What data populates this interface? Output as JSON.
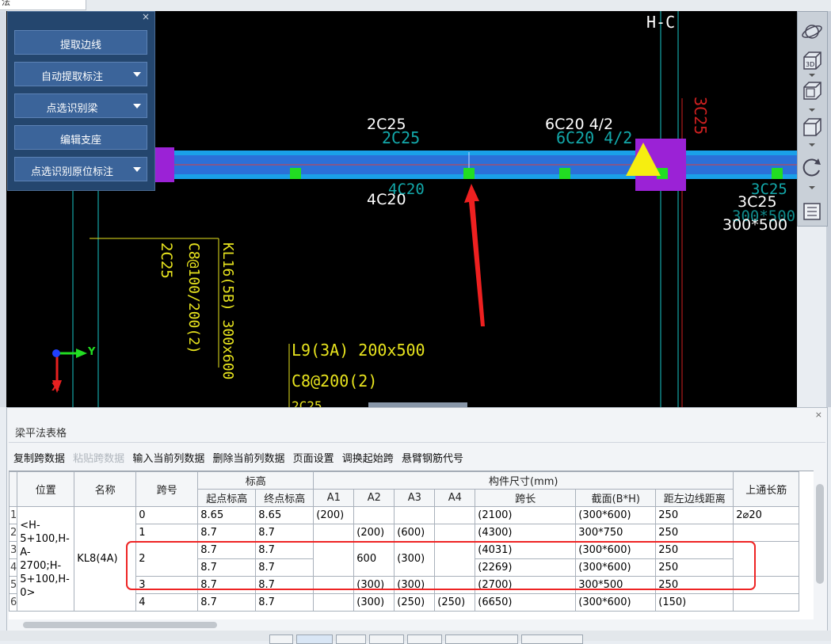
{
  "top_strip_text": "法",
  "panel": {
    "close": "×",
    "buttons": [
      {
        "label": "提取边线",
        "dropdown": false
      },
      {
        "label": "自动提取标注",
        "dropdown": true
      },
      {
        "label": "点选识别梁",
        "dropdown": true
      },
      {
        "label": "编辑支座",
        "dropdown": false
      },
      {
        "label": "点选识别原位标注",
        "dropdown": true
      }
    ]
  },
  "canvas": {
    "axis_label": "H-C",
    "labels": {
      "top_2c25": "2C25",
      "top_2c25_ghost": "2C25",
      "top_6c20": "6C20 4/2",
      "top_6c20_ghost": "6C20 4/2",
      "bottom_4c20": "4C20",
      "bottom_4c20_ghost": "4C20",
      "right_3c25": "3C25",
      "right_3c25_ghost": "3C25",
      "right_300": "300*500",
      "right_300_ghost": "300*500",
      "vertical_3c25": "3C25",
      "vertical_2c25": "2C25",
      "vertical_c8": "C8@100/200(2)",
      "vertical_kl16": "KL16(5B) 300x600",
      "l9": "L9(3A) 200x500",
      "c8_200": "C8@200(2)",
      "partial": "2C25",
      "ucs_x": "X",
      "ucs_y": "Y"
    }
  },
  "toolbar": {
    "icons": [
      "orbit-icon",
      "3d-view-icon",
      "top-view-icon",
      "box-view-icon",
      "rotate-icon",
      "properties-icon"
    ],
    "label_3d": "3D"
  },
  "table_panel": {
    "close": "×",
    "title": "梁平法表格",
    "actions": [
      {
        "label": "复制跨数据",
        "enabled": true
      },
      {
        "label": "粘贴跨数据",
        "enabled": false
      },
      {
        "label": "输入当前列数据",
        "enabled": true
      },
      {
        "label": "删除当前列数据",
        "enabled": true
      },
      {
        "label": "页面设置",
        "enabled": true
      },
      {
        "label": "调换起始跨",
        "enabled": true
      },
      {
        "label": "悬臂钢筋代号",
        "enabled": true
      }
    ],
    "headers": {
      "position": "位置",
      "name": "名称",
      "span": "跨号",
      "elevation": "标高",
      "start_elev": "起点标高",
      "end_elev": "终点标高",
      "dims": "构件尺寸(mm)",
      "a1": "A1",
      "a2": "A2",
      "a3": "A3",
      "a4": "A4",
      "span_len": "跨长",
      "section": "截面(B*H)",
      "left_dist": "距左边线距离",
      "top_rebar": "上通长筋"
    },
    "position_value": "<H-5+100,H-A-2700;H-5+100,H-0>",
    "name_value": "KL8(4A)",
    "row_numbers": [
      "1",
      "2",
      "3",
      "4",
      "5",
      "6"
    ],
    "rows": [
      {
        "span": "0",
        "start": "8.65",
        "end": "8.65",
        "a1": "(200)",
        "a2": "",
        "a3": "",
        "a4": "",
        "len": "(2100)",
        "sec": "(300*600)",
        "dist": "250",
        "top": "2⌀20"
      },
      {
        "span": "1",
        "start": "8.7",
        "end": "8.7",
        "a1": "",
        "a2": "(200)",
        "a3": "(600)",
        "a4": "",
        "len": "(4300)",
        "sec": "300*750",
        "dist": "250",
        "top": ""
      },
      {
        "span": "2",
        "start": "8.7",
        "end": "8.7",
        "a1": "",
        "a2": "600",
        "a3": "(300)",
        "a4": "",
        "len": "(4031)",
        "sec": "(300*600)",
        "dist": "250",
        "top": ""
      },
      {
        "span": "",
        "start": "8.7",
        "end": "8.7",
        "a1": "",
        "a2": "",
        "a3": "",
        "a4": "",
        "len": "(2269)",
        "sec": "(300*600)",
        "dist": "250",
        "top": ""
      },
      {
        "span": "3",
        "start": "8.7",
        "end": "8.7",
        "a1": "",
        "a2": "(300)",
        "a3": "(300)",
        "a4": "",
        "len": "(2700)",
        "sec": "300*500",
        "dist": "250",
        "top": ""
      },
      {
        "span": "4",
        "start": "8.7",
        "end": "8.7",
        "a1": "",
        "a2": "(300)",
        "a3": "(250)",
        "a4": "(250)",
        "len": "(6650)",
        "sec": "(300*600)",
        "dist": "(150)",
        "top": ""
      }
    ]
  }
}
